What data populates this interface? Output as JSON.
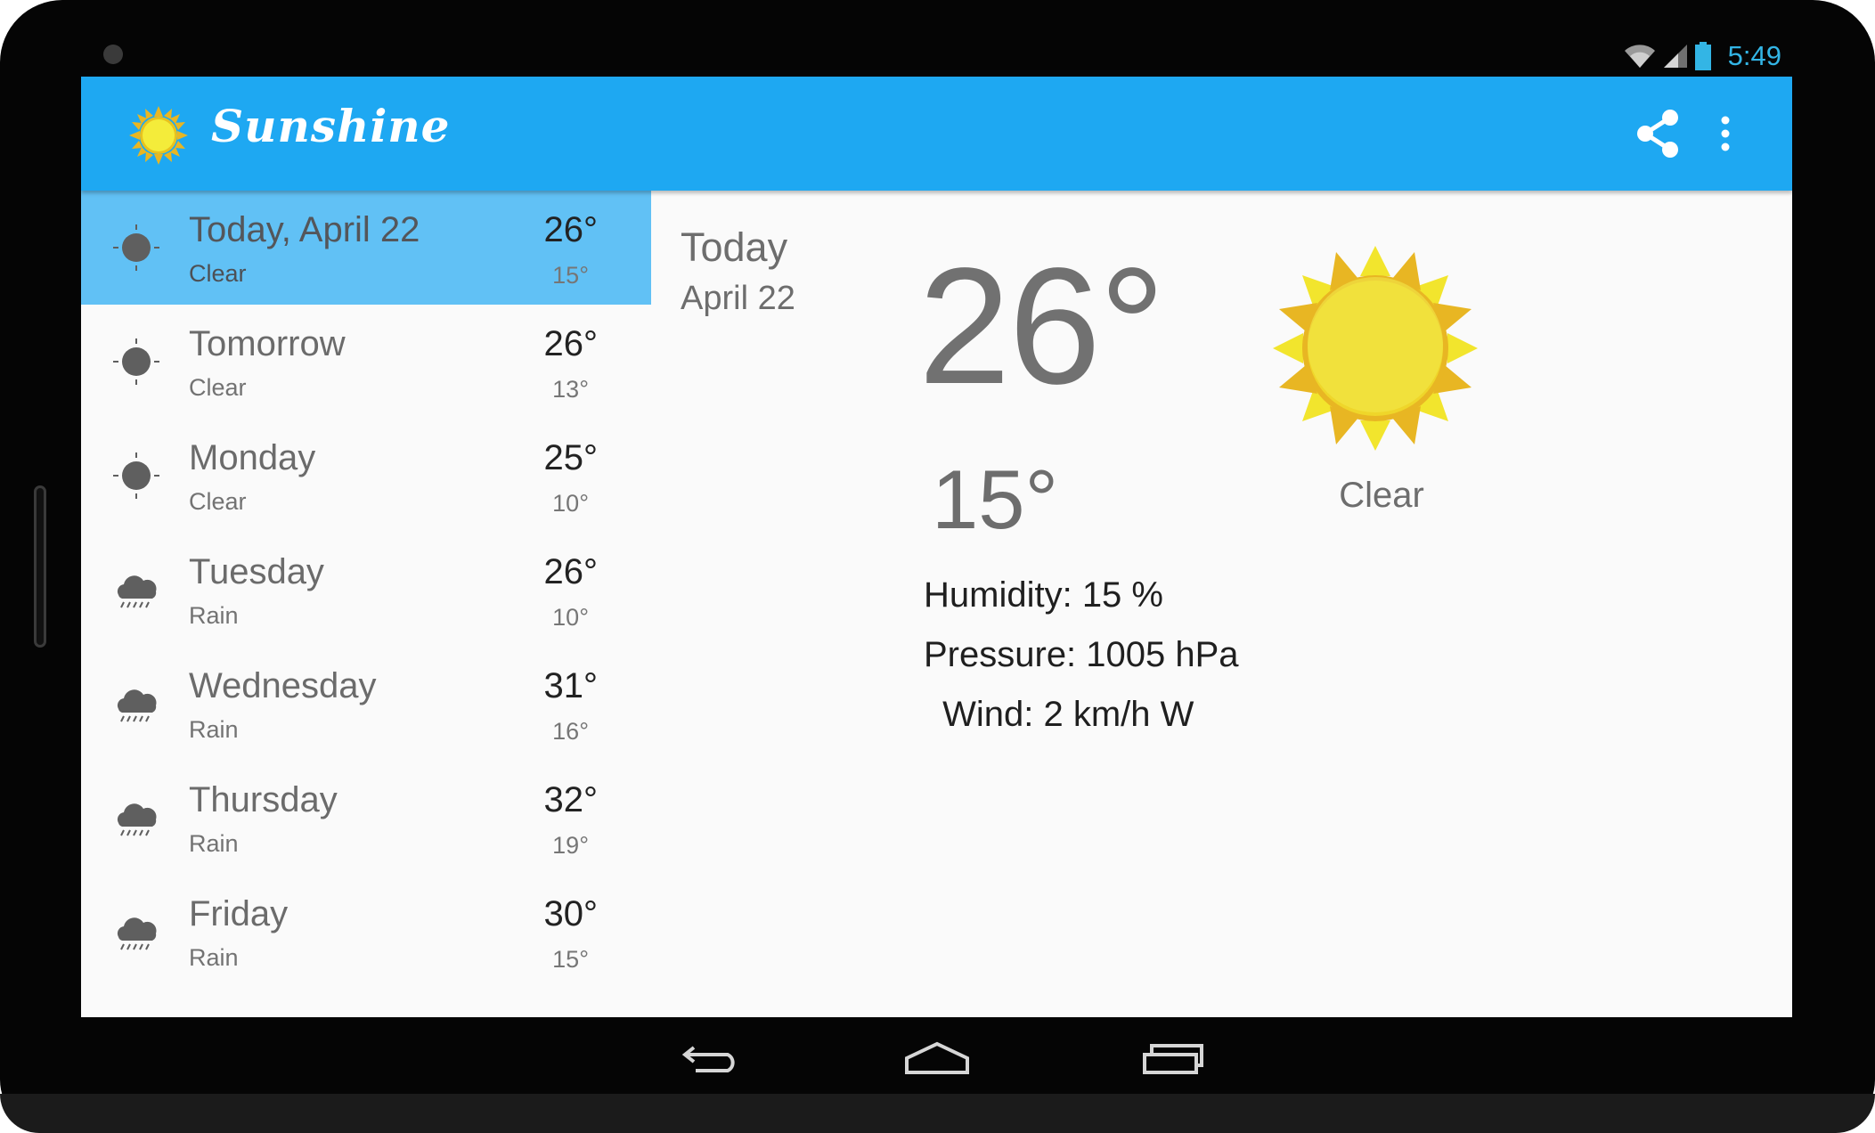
{
  "status_bar": {
    "time": "5:49",
    "icons": [
      "wifi-icon",
      "cell-signal-icon",
      "battery-icon"
    ]
  },
  "app": {
    "title": "Sunshine",
    "logo": "sun-logo-icon",
    "actions": [
      "share-icon",
      "overflow-menu-icon"
    ]
  },
  "forecast": [
    {
      "day": "Today, April 22",
      "condition": "Clear",
      "high": "26°",
      "low": "15°",
      "icon": "clear-icon",
      "selected": true
    },
    {
      "day": "Tomorrow",
      "condition": "Clear",
      "high": "26°",
      "low": "13°",
      "icon": "clear-icon"
    },
    {
      "day": "Monday",
      "condition": "Clear",
      "high": "25°",
      "low": "10°",
      "icon": "clear-icon"
    },
    {
      "day": "Tuesday",
      "condition": "Rain",
      "high": "26°",
      "low": "10°",
      "icon": "rain-icon"
    },
    {
      "day": "Wednesday",
      "condition": "Rain",
      "high": "31°",
      "low": "16°",
      "icon": "rain-icon"
    },
    {
      "day": "Thursday",
      "condition": "Rain",
      "high": "32°",
      "low": "19°",
      "icon": "rain-icon"
    },
    {
      "day": "Friday",
      "condition": "Rain",
      "high": "30°",
      "low": "15°",
      "icon": "rain-icon"
    }
  ],
  "detail": {
    "day": "Today",
    "date": "April 22",
    "high": "26°",
    "low": "15°",
    "humidity": "Humidity: 15 %",
    "pressure": "Pressure: 1005 hPa",
    "wind": " Wind: 2 km/h W",
    "description": "Clear",
    "art": "sun-art-icon"
  },
  "colors": {
    "action_bar": "#1ea8f2",
    "selected_row": "#61c1f5",
    "status_accent": "#33b5e5",
    "sun_yellow": "#f2e52d",
    "sun_orange": "#e8b623"
  },
  "nav": [
    "back-icon",
    "home-icon",
    "recents-icon"
  ]
}
